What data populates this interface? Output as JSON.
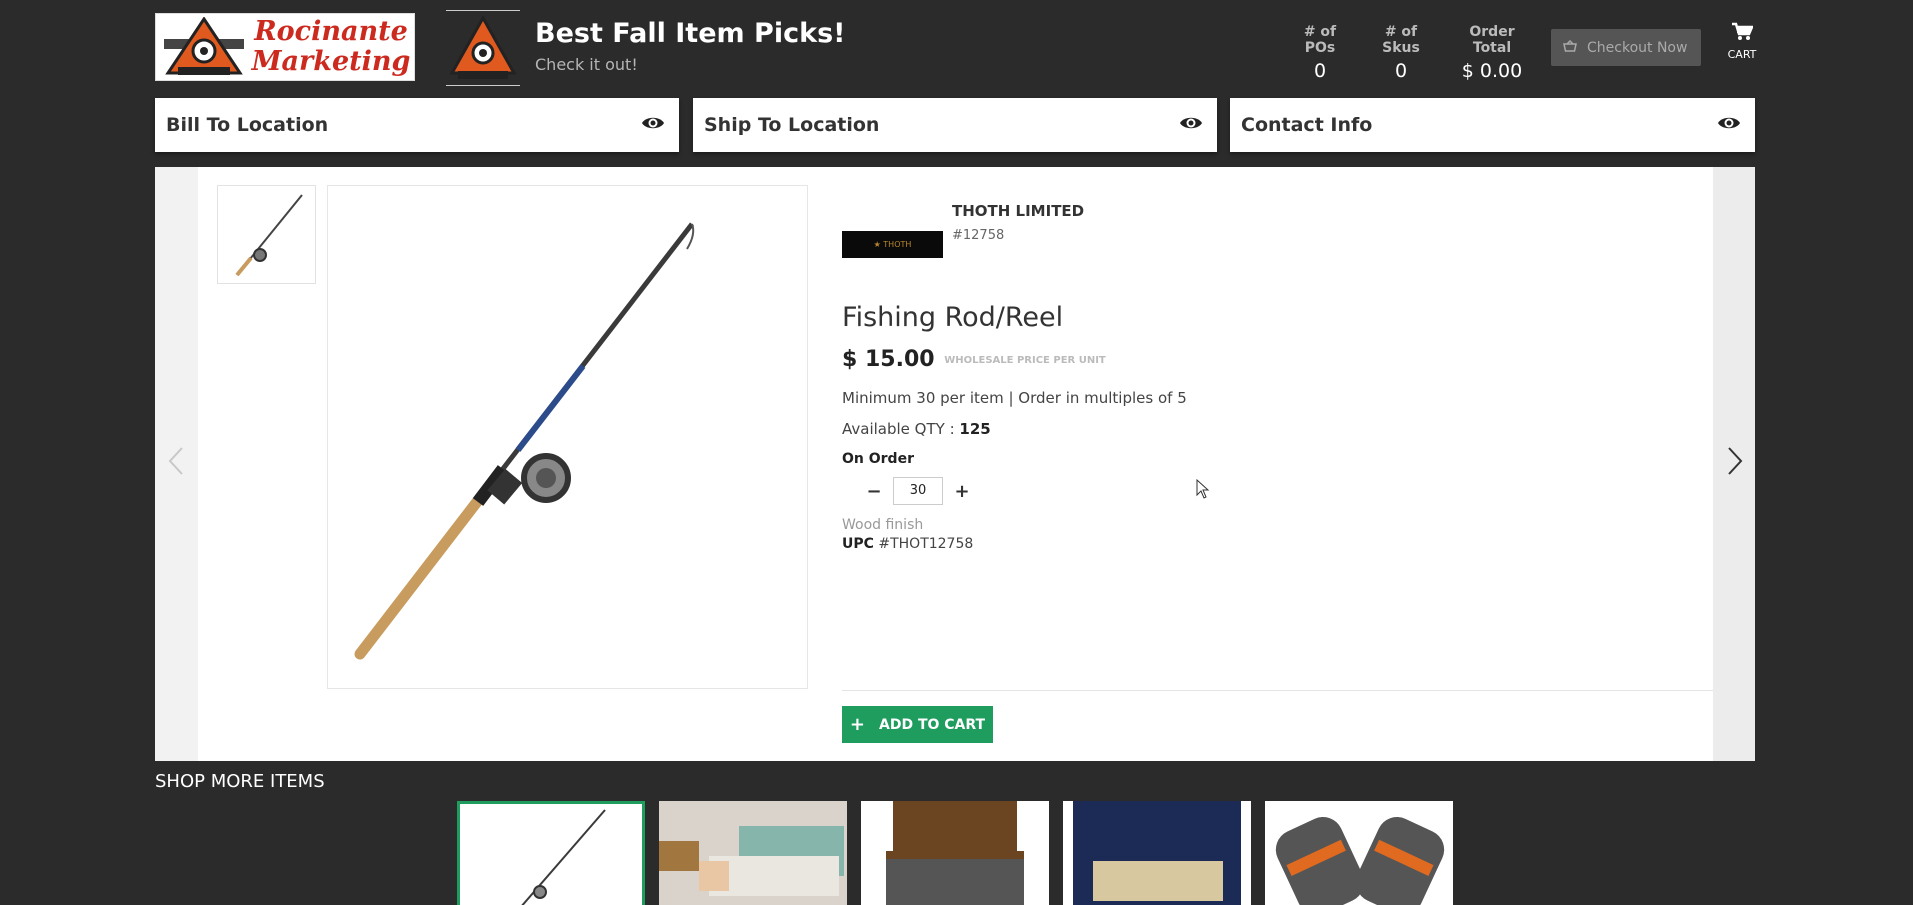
{
  "header": {
    "brand_line1": "Rocinante",
    "brand_line2": "Marketing",
    "store_title": "Best Fall Item Picks!",
    "store_subtitle": "Check it out!",
    "stats": {
      "pos_label": "# of POs",
      "pos_value": "0",
      "skus_label": "# of Skus",
      "skus_value": "0",
      "total_label": "Order Total",
      "total_value": "$ 0.00"
    },
    "checkout_label": "Checkout Now",
    "cart_label": "CART"
  },
  "locations": {
    "bill_to": "Bill To Location",
    "ship_to": "Ship To Location",
    "contact": "Contact Info"
  },
  "product": {
    "brand_name": "THOTH LIMITED",
    "brand_number": "#12758",
    "name": "Fishing Rod/Reel",
    "price": "$ 15.00",
    "price_note": "WHOLESALE PRICE PER UNIT",
    "min_order": "Minimum 30 per item | Order in multiples of 5",
    "available_label": "Available QTY :",
    "available_value": "125",
    "on_order_label": "On Order",
    "quantity": "30",
    "finish": "Wood finish",
    "upc_label": "UPC",
    "upc_value": "#THOT12758",
    "add_to_cart": "ADD TO CART"
  },
  "shop_more": {
    "title": "SHOP MORE ITEMS",
    "items": [
      "fishing-rod",
      "green-bed",
      "wood-bed",
      "navy-bed",
      "dumbbells"
    ]
  },
  "colors": {
    "accent_green": "#1f9d5f",
    "background": "#2b2b2b",
    "logo_red": "#cc2a1f"
  }
}
